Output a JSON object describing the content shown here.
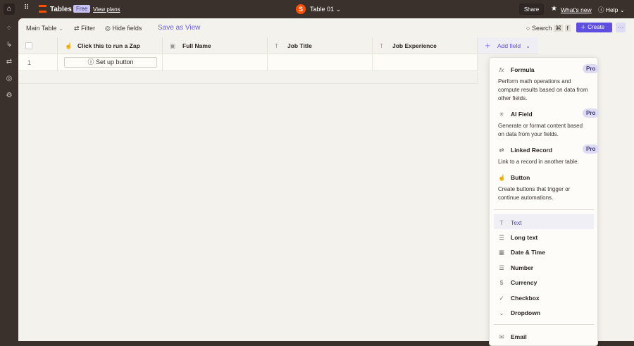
{
  "topbar": {
    "app": "Tables",
    "plan_badge": "Free",
    "view_plans": "View plans",
    "table_name": "Table 01",
    "share": "Share",
    "whats_new": "What's new",
    "help": "Help"
  },
  "toolbar": {
    "view": "Main Table",
    "filter": "Filter",
    "hide_fields": "Hide fields",
    "save_view": "Save as View",
    "search": "Search",
    "shortcut_cmd": "⌘",
    "shortcut_key": "f",
    "create": "Create"
  },
  "columns": [
    {
      "label": "Click this to run a Zap",
      "icon": "button-icon"
    },
    {
      "label": "Full Name",
      "icon": "name-icon"
    },
    {
      "label": "Job Title",
      "icon": "text-icon"
    },
    {
      "label": "Job Experience",
      "icon": "text-icon"
    }
  ],
  "add_field": "Add field",
  "rows": [
    {
      "num": "1",
      "button": "Set up button"
    }
  ],
  "menu": {
    "featured": [
      {
        "label": "Formula",
        "badge": "Pro",
        "desc": "Perform math operations and compute results based on data from other fields."
      },
      {
        "label": "AI Field",
        "badge": "Pro",
        "desc": "Generate or format content based on data from your fields."
      },
      {
        "label": "Linked Record",
        "badge": "Pro",
        "desc": "Link to a record in another table."
      },
      {
        "label": "Button",
        "desc": "Create buttons that trigger or continue automations."
      }
    ],
    "types": [
      "Text",
      "Long text",
      "Date & Time",
      "Number",
      "Currency",
      "Checkbox",
      "Dropdown"
    ],
    "more": [
      "Email"
    ]
  },
  "colors": {
    "accent": "#5e4fe0",
    "brand": "#ff4f00"
  }
}
